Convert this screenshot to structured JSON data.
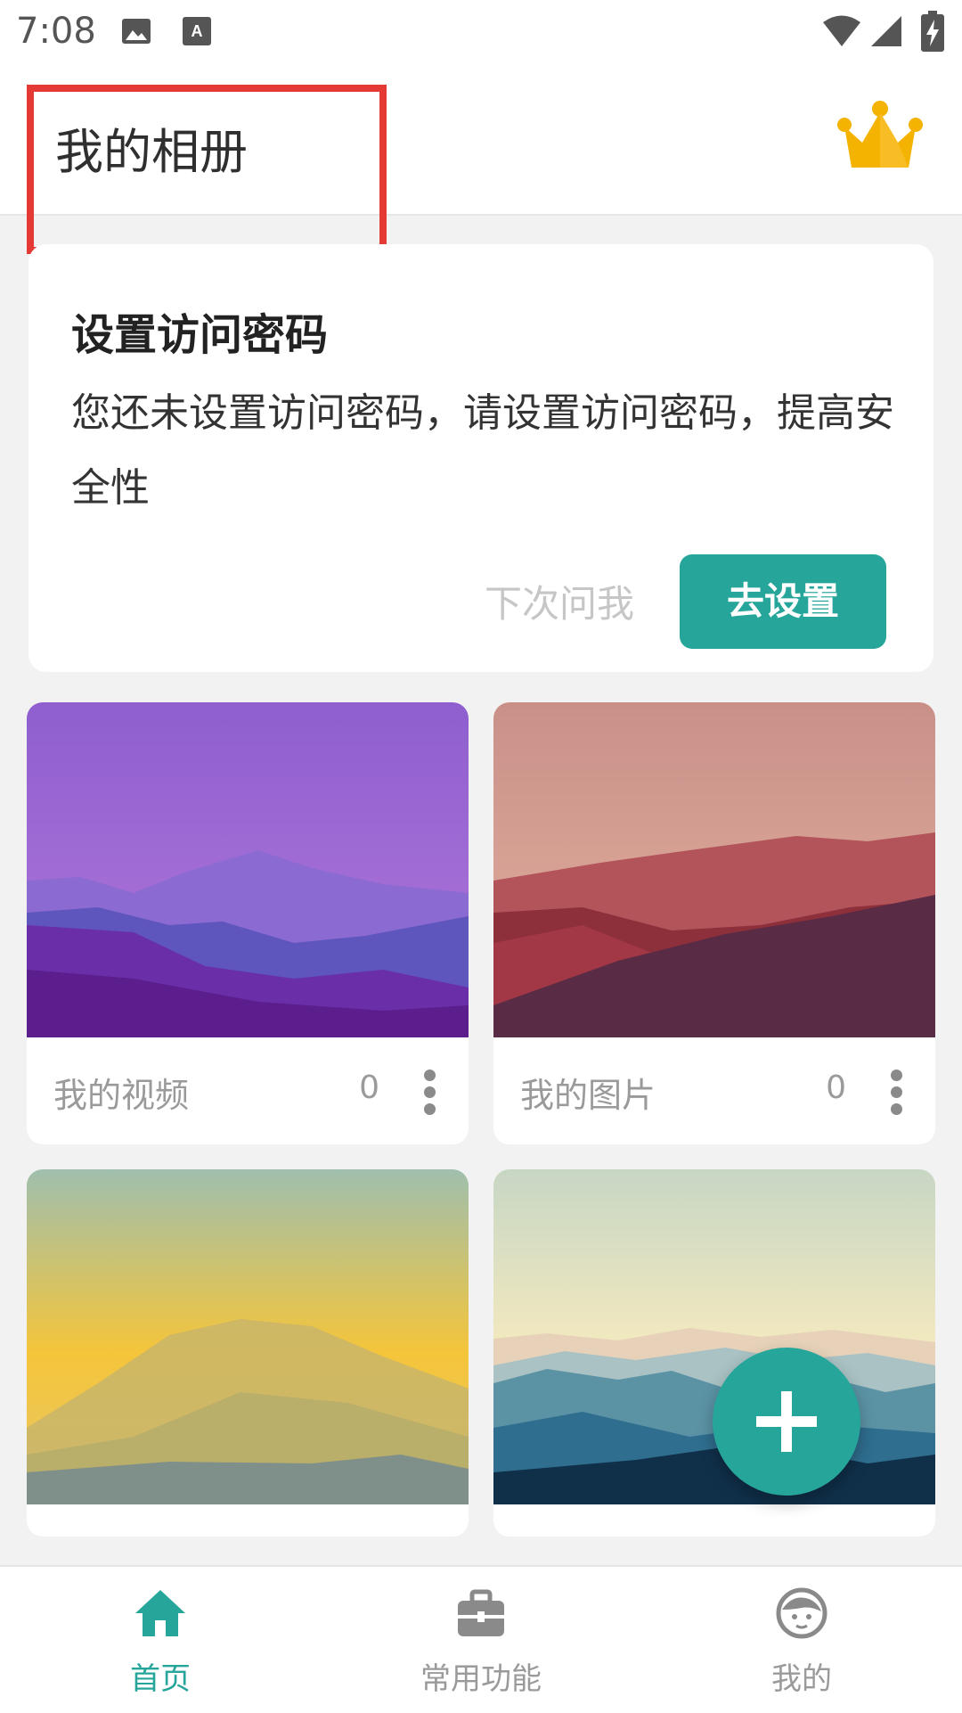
{
  "status_bar": {
    "time": "7:08"
  },
  "app_bar": {
    "title": "我的相册",
    "vip_icon": "crown-icon"
  },
  "password_card": {
    "title": "设置访问密码",
    "description": "您还未设置访问密码，请设置访问密码，提高安全性",
    "later_label": "下次问我",
    "set_label": "去设置"
  },
  "albums": [
    {
      "name": "我的视频",
      "count": "0"
    },
    {
      "name": "我的图片",
      "count": "0"
    },
    {
      "name": "",
      "count": ""
    },
    {
      "name": "",
      "count": ""
    }
  ],
  "bottom_nav": [
    {
      "label": "首页",
      "icon": "home-icon",
      "active": true
    },
    {
      "label": "常用功能",
      "icon": "toolbox-icon",
      "active": false
    },
    {
      "label": "我的",
      "icon": "profile-icon",
      "active": false
    }
  ],
  "colors": {
    "accent": "#26a69a",
    "highlight": "#e53935",
    "crown": "#f5b301"
  }
}
